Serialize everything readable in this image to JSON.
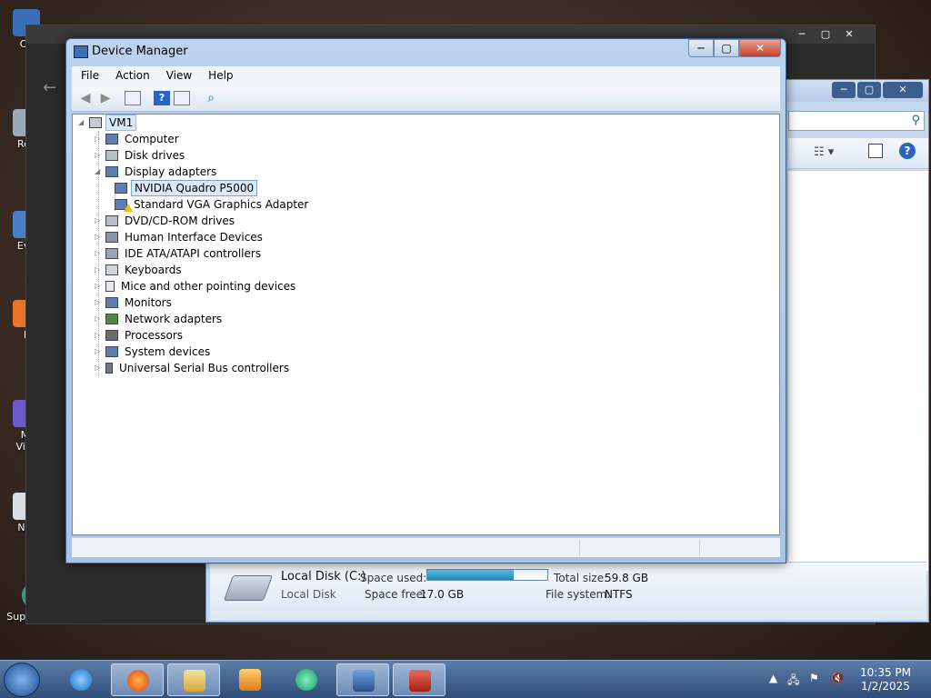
{
  "device_manager": {
    "title": "Device Manager",
    "menu": [
      "File",
      "Action",
      "View",
      "Help"
    ],
    "tree": {
      "root": "VM1",
      "nodes": [
        {
          "label": "Computer"
        },
        {
          "label": "Disk drives"
        },
        {
          "label": "Display adapters",
          "expanded": true,
          "children": [
            "NVIDIA Quadro P5000",
            "Standard VGA Graphics Adapter"
          ]
        },
        {
          "label": "DVD/CD-ROM drives"
        },
        {
          "label": "Human Interface Devices"
        },
        {
          "label": "IDE ATA/ATAPI controllers"
        },
        {
          "label": "Keyboards"
        },
        {
          "label": "Mice and other pointing devices"
        },
        {
          "label": "Monitors"
        },
        {
          "label": "Network adapters"
        },
        {
          "label": "Processors"
        },
        {
          "label": "System devices"
        },
        {
          "label": "Universal Serial Bus controllers"
        }
      ],
      "selected": "NVIDIA Quadro P5000",
      "warning_device": "Standard VGA Graphics Adapter"
    }
  },
  "explorer": {
    "disk": {
      "name": "Local Disk (C:)",
      "type": "Local Disk",
      "space_used_label": "Space used:",
      "space_free_label": "Space free:",
      "space_free": "17.0 GB",
      "total_size_label": "Total size:",
      "total_size": "59.8 GB",
      "file_system_label": "File system:",
      "file_system": "NTFS",
      "used_fraction": 0.72
    }
  },
  "desktop_icons": [
    "Co",
    "Rec",
    "Eve",
    "F",
    "Mi",
    "Visu",
    "Not",
    "Supermium"
  ],
  "taskbar": {
    "clock_time": "10:35 PM",
    "clock_date": "1/2/2025"
  },
  "colors": {
    "selection": "#dbe8f7",
    "progress": "#1e8ab8",
    "close_button": "#c7402a"
  }
}
